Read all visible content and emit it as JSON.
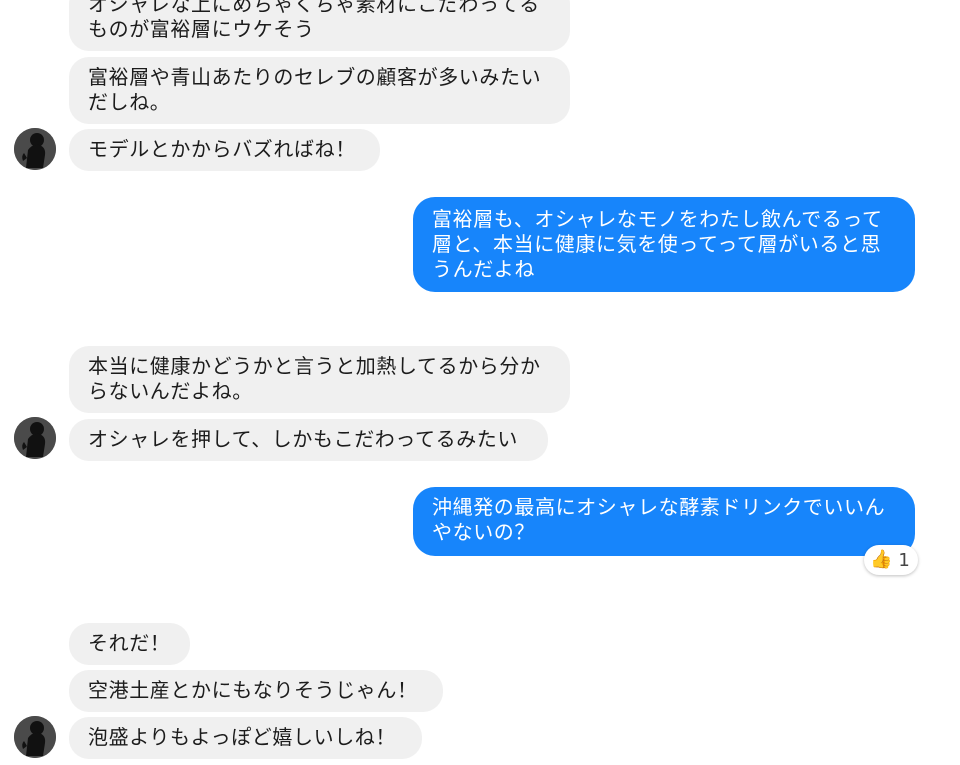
{
  "conversation": {
    "messages": [
      {
        "sender": "them",
        "text": "オシャレな上にめちゃくちゃ素材にこだわってる\nものが富裕層にウケそう"
      },
      {
        "sender": "them",
        "text": "富裕層や青山あたりのセレブの顧客が多いみたい\nだしね。"
      },
      {
        "sender": "them",
        "text": "モデルとかからバズればね！"
      },
      {
        "sender": "me",
        "text": "富裕層も、オシャレなモノをわたし飲んでるって\n層と、本当に健康に気を使ってって層がいると思\nうんだよね"
      },
      {
        "sender": "them",
        "text": "本当に健康かどうかと言うと加熱してるから分か\nらないんだよね。"
      },
      {
        "sender": "them",
        "text": "オシャレを押して、しかもこだわってるみたい"
      },
      {
        "sender": "me",
        "text": "沖縄発の最高にオシャレな酵素ドリンクでいいん\nやないの？"
      },
      {
        "sender": "them",
        "text": "それだ！"
      },
      {
        "sender": "them",
        "text": "空港土産とかにもなりそうじゃん！"
      },
      {
        "sender": "them",
        "text": "泡盛よりもよっぽど嬉しいしね！"
      }
    ],
    "reaction": {
      "icon": "thumbs-up-icon",
      "emoji": "👍",
      "count": "1"
    }
  },
  "colors": {
    "outgoing": "#1785fb",
    "incoming": "#f0f0f0"
  }
}
